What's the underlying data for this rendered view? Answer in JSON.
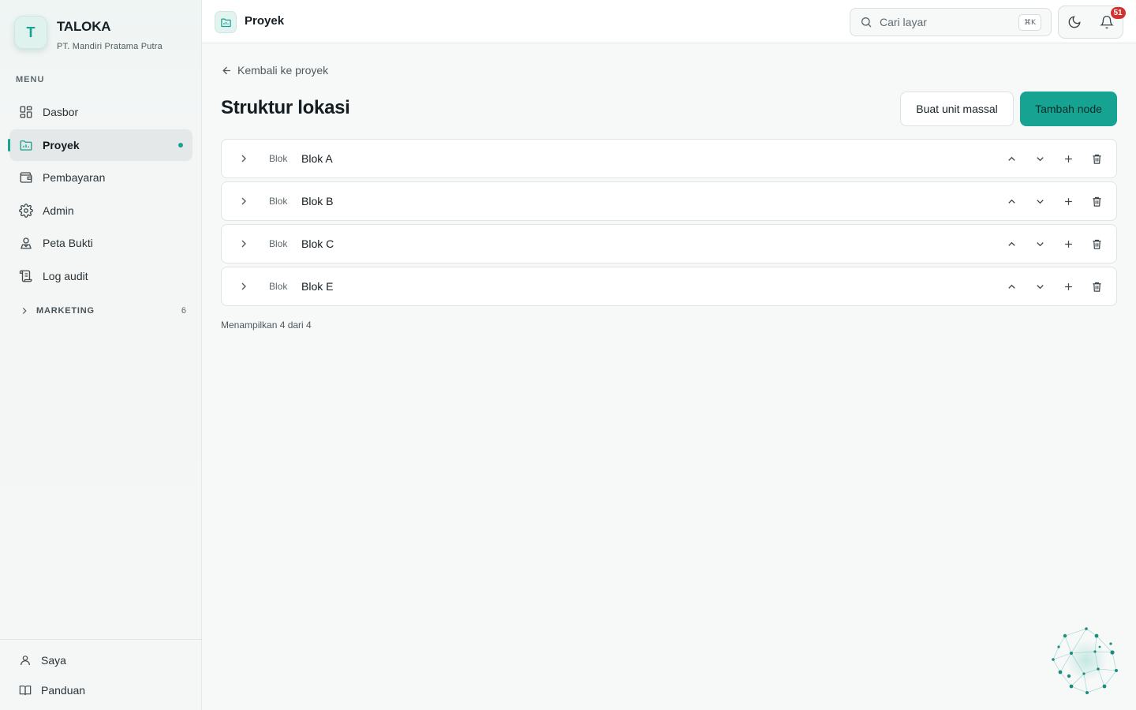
{
  "brand": {
    "logo_letter": "T",
    "name": "TALOKA",
    "company": "PT. Mandiri Pratama Putra"
  },
  "sidebar": {
    "menu_label": "MENU",
    "items": [
      {
        "label": "Dasbor",
        "icon": "dashboard-icon",
        "active": false
      },
      {
        "label": "Proyek",
        "icon": "folder-chart-icon",
        "active": true
      },
      {
        "label": "Pembayaran",
        "icon": "wallet-icon",
        "active": false
      },
      {
        "label": "Admin",
        "icon": "gear-icon",
        "active": false
      },
      {
        "label": "Peta Bukti",
        "icon": "map-user-icon",
        "active": false
      },
      {
        "label": "Log audit",
        "icon": "scroll-icon",
        "active": false
      }
    ],
    "section": {
      "label": "MARKETING",
      "count": "6"
    },
    "footer": [
      {
        "label": "Saya",
        "icon": "user-icon"
      },
      {
        "label": "Panduan",
        "icon": "book-icon"
      }
    ]
  },
  "header": {
    "title": "Proyek",
    "search_placeholder": "Cari layar",
    "search_shortcut": "⌘K",
    "notification_count": "51"
  },
  "main": {
    "back_label": "Kembali ke proyek",
    "heading": "Struktur lokasi",
    "bulk_button": "Buat unit massal",
    "add_button": "Tambah node",
    "rows": [
      {
        "type": "Blok",
        "name": "Blok A"
      },
      {
        "type": "Blok",
        "name": "Blok B"
      },
      {
        "type": "Blok",
        "name": "Blok C"
      },
      {
        "type": "Blok",
        "name": "Blok E"
      }
    ],
    "result_count": "Menampilkan 4 dari 4"
  },
  "colors": {
    "accent": "#17a391",
    "badge": "#d2322d",
    "text": "#141d21"
  }
}
